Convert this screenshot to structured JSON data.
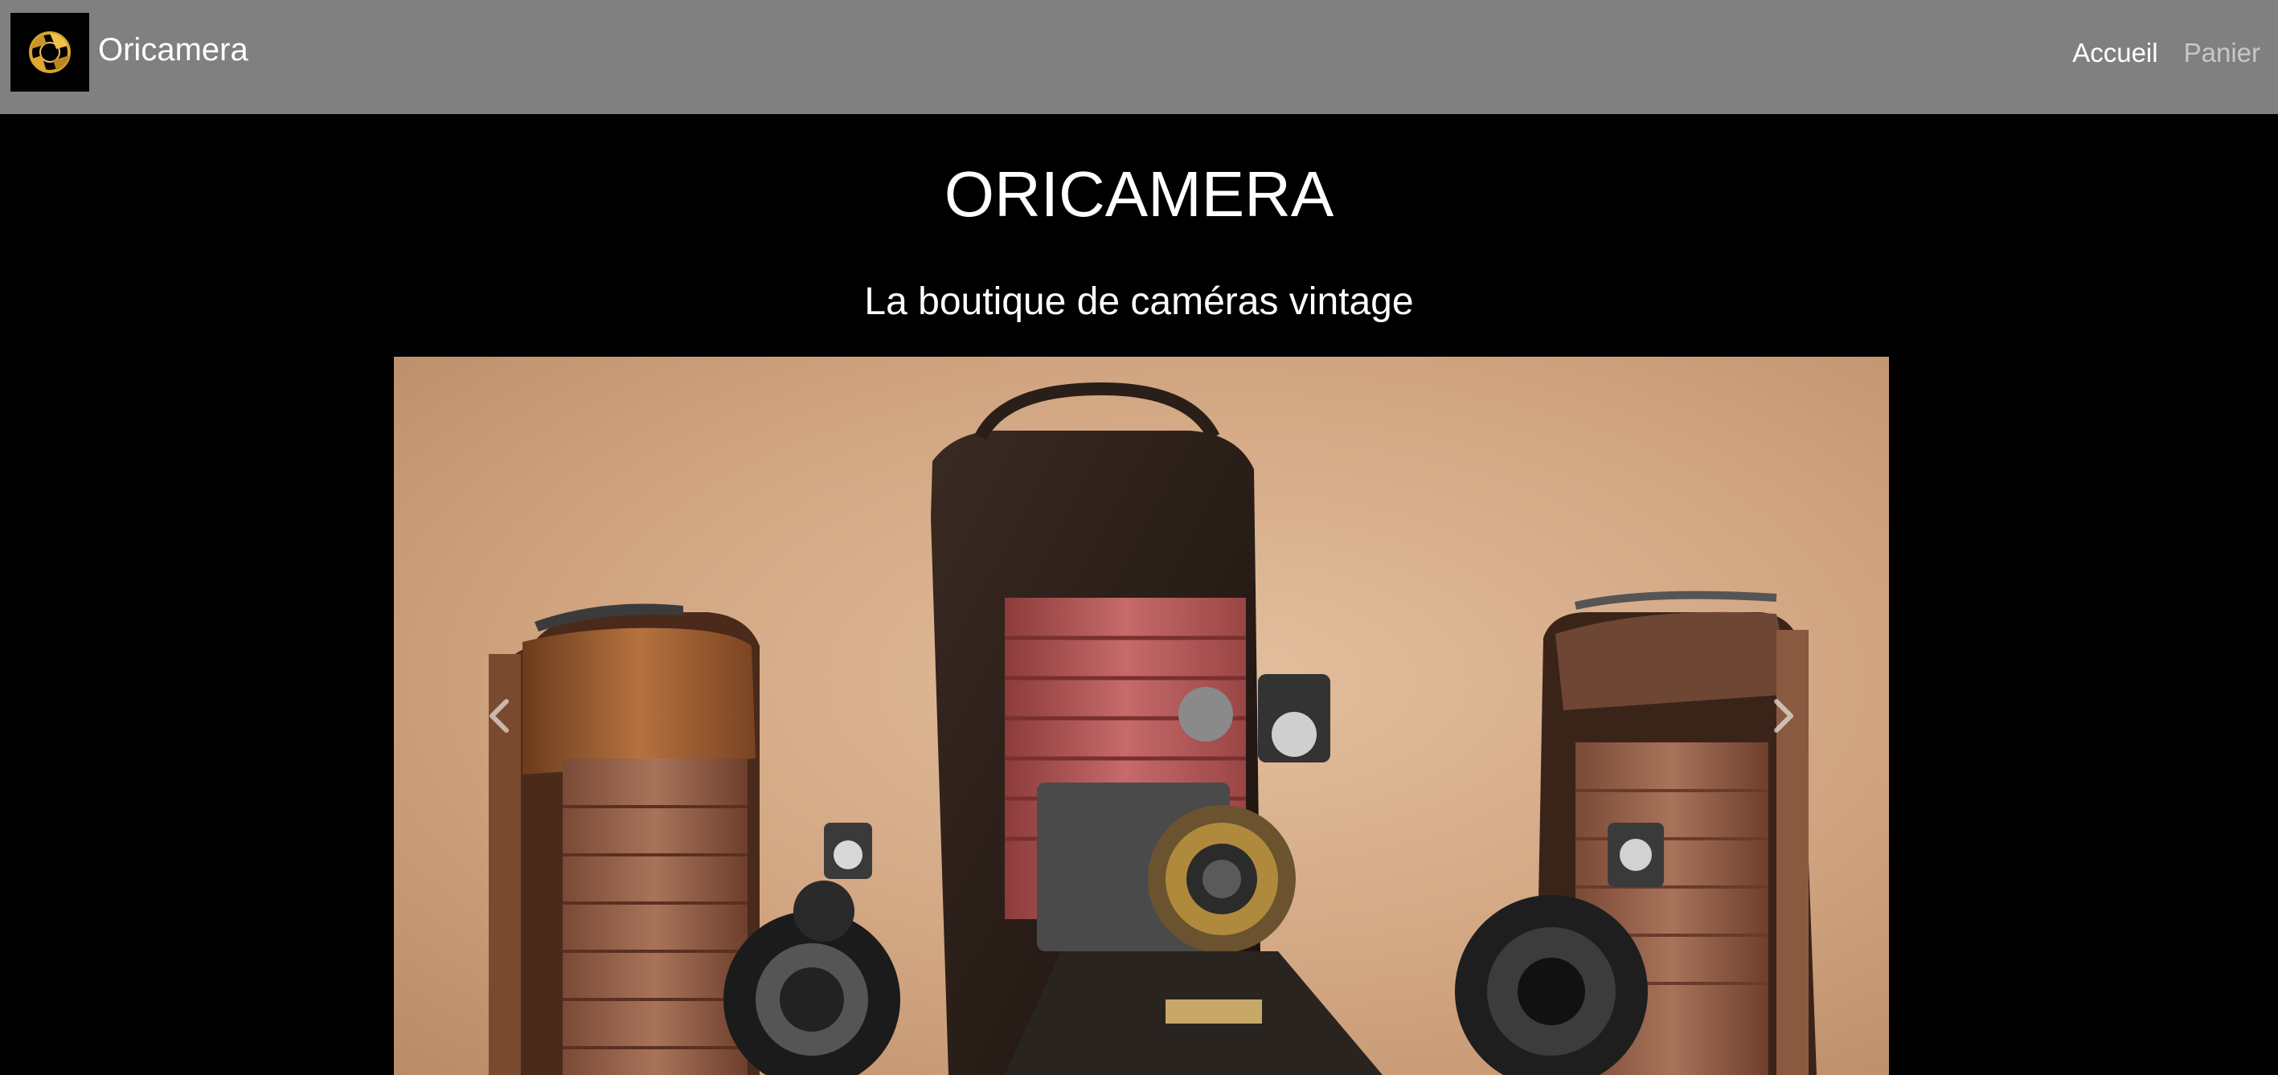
{
  "navbar": {
    "brand_name": "Oricamera",
    "logo_icon": "camera-aperture-icon",
    "links": [
      {
        "label": "Accueil",
        "state": "active"
      },
      {
        "label": "Panier",
        "state": "inactive"
      }
    ]
  },
  "hero": {
    "title": "ORICAMERA",
    "subtitle": "La boutique de caméras vintage"
  },
  "carousel": {
    "prev_icon": "chevron-left-icon",
    "next_icon": "chevron-right-icon",
    "slide_image": "vintage-folding-cameras-photo"
  },
  "colors": {
    "navbar_bg": "#808080",
    "page_bg": "#000000",
    "nav_active": "#ffffff",
    "nav_muted": "#c8c8c8"
  }
}
